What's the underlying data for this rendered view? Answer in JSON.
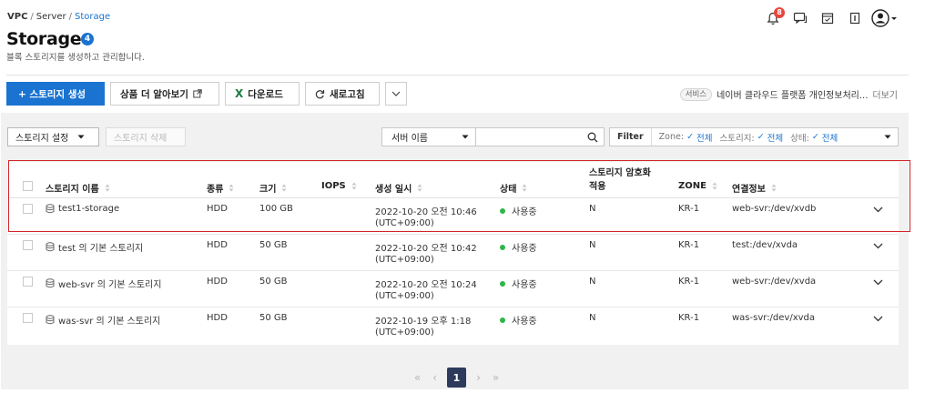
{
  "breadcrumb": {
    "vpc": "VPC",
    "server": "Server",
    "current": "Storage",
    "sep": "/"
  },
  "page": {
    "title": "Storage",
    "badge": "4",
    "description": "블록 스토리지를 생성하고 관리합니다."
  },
  "top_icons": {
    "notification_count": "8",
    "icons": [
      "bell-icon",
      "chat-icon",
      "calendar-icon",
      "document-icon",
      "user-avatar-icon"
    ]
  },
  "toolbar": {
    "create_label": "+ 스토리지 생성",
    "learn_more_label": "상품 더 알아보기",
    "download_label": "다운로드",
    "refresh_label": "새로고침"
  },
  "service": {
    "tag": "서비스",
    "text": "네이버 클라우드 플랫폼 개인정보처리...",
    "more": "더보기"
  },
  "panel": {
    "settings_label": "스토리지 설정",
    "delete_label": "스토리지 삭제",
    "search_select": "서버 이름",
    "search_value": "",
    "filter_label": "Filter",
    "filters": [
      {
        "label": "Zone:",
        "value": "전체"
      },
      {
        "label": "스토리지:",
        "value": "전체"
      },
      {
        "label": "상태:",
        "value": "전체"
      }
    ]
  },
  "table": {
    "columns": [
      "스토리지 이름",
      "종류",
      "크기",
      "IOPS",
      "생성 일시",
      "상태",
      "스토리지 암호화",
      "적용",
      "ZONE",
      "연결정보"
    ],
    "rows": [
      {
        "name": "test1-storage",
        "type": "HDD",
        "size": "100 GB",
        "iops": "",
        "created": "2022-10-20 오전 10:46",
        "tz": "(UTC+09:00)",
        "status": "사용중",
        "encryption": "N",
        "zone": "KR-1",
        "connection": "web-svr:/dev/xvdb"
      },
      {
        "name": "test 의 기본 스토리지",
        "type": "HDD",
        "size": "50 GB",
        "iops": "",
        "created": "2022-10-20 오전 10:42",
        "tz": "(UTC+09:00)",
        "status": "사용중",
        "encryption": "N",
        "zone": "KR-1",
        "connection": "test:/dev/xvda"
      },
      {
        "name": "web-svr 의 기본 스토리지",
        "type": "HDD",
        "size": "50 GB",
        "iops": "",
        "created": "2022-10-20 오전 10:24",
        "tz": "(UTC+09:00)",
        "status": "사용중",
        "encryption": "N",
        "zone": "KR-1",
        "connection": "web-svr:/dev/xvda"
      },
      {
        "name": "was-svr 의 기본 스토리지",
        "type": "HDD",
        "size": "50 GB",
        "iops": "",
        "created": "2022-10-19 오후 1:18",
        "tz": "(UTC+09:00)",
        "status": "사용중",
        "encryption": "N",
        "zone": "KR-1",
        "connection": "was-svr:/dev/xvda"
      }
    ]
  },
  "pagination": {
    "current": "1"
  },
  "colors": {
    "primary": "#1a73d1",
    "status_active": "#2db64a",
    "highlight": "#d2232a",
    "page_active": "#2d3a5c",
    "notif_badge": "#e8453c"
  }
}
